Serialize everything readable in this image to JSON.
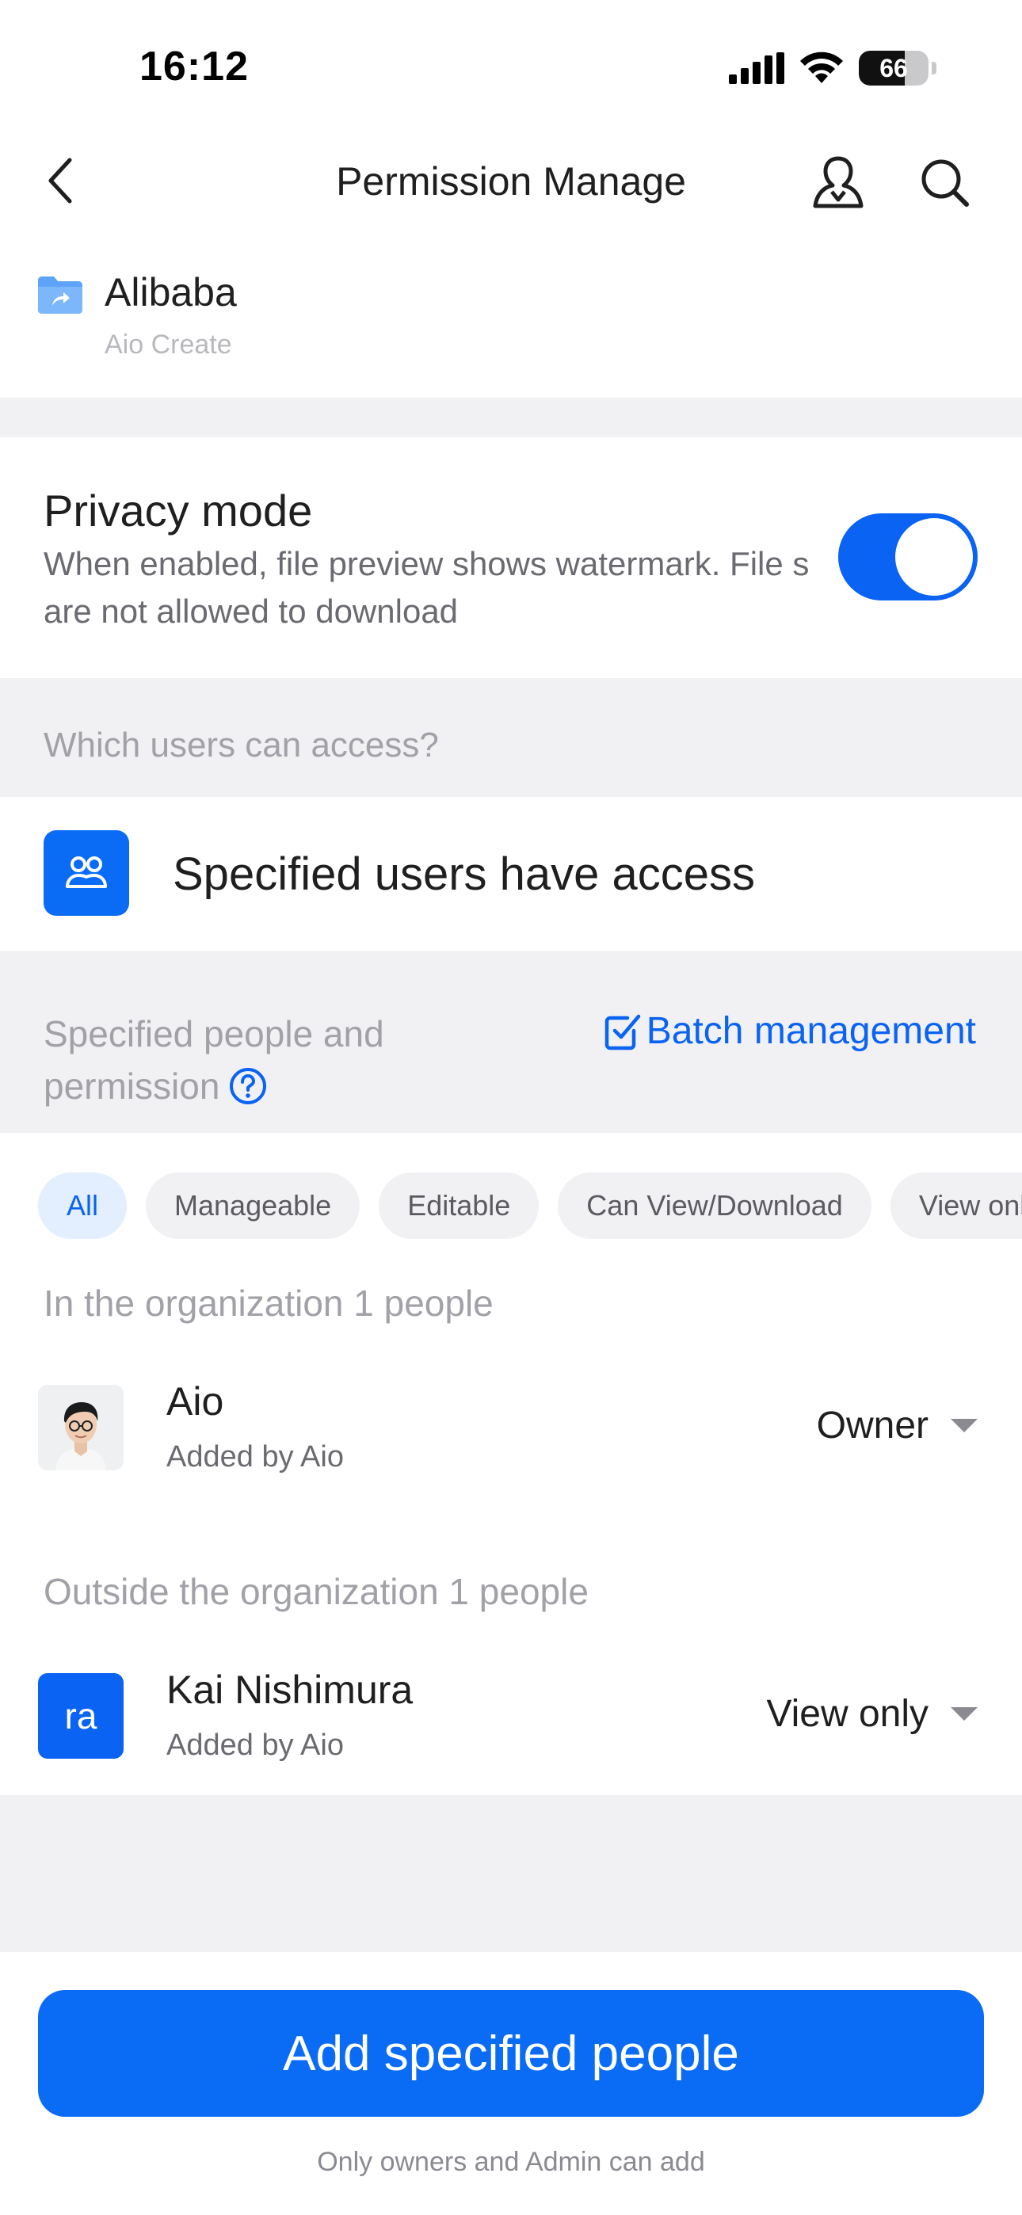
{
  "status": {
    "time": "16:12",
    "battery": "66",
    "battery_level": 0.66
  },
  "nav": {
    "title": "Permission Manage",
    "icons": [
      "back-icon",
      "user-icon",
      "search-icon"
    ]
  },
  "file": {
    "name": "Alibaba",
    "creator": "Aio Create",
    "icon": "shared-folder-icon"
  },
  "privacy": {
    "title": "Privacy mode",
    "description": "When enabled, file preview shows watermark. File s are not allowed to download",
    "enabled": true
  },
  "access": {
    "question": "Which users can access?",
    "option_label": "Specified users have access",
    "icon": "group-icon"
  },
  "people_header": {
    "label": "Specified people and permission",
    "batch_label": "Batch management"
  },
  "filters": [
    {
      "label": "All",
      "active": true
    },
    {
      "label": "Manageable",
      "active": false
    },
    {
      "label": "Editable",
      "active": false
    },
    {
      "label": "Can View/Download",
      "active": false
    },
    {
      "label": "View only",
      "active": false
    }
  ],
  "sections": [
    {
      "label": "In the organization 1 people",
      "members": [
        {
          "name": "Aio",
          "added_by": "Added by Aio",
          "role": "Owner",
          "avatar_type": "photo",
          "avatar_text": ""
        }
      ]
    },
    {
      "label": "Outside the organization 1 people",
      "members": [
        {
          "name": "Kai Nishimura",
          "added_by": "Added by Aio",
          "role": "View only",
          "avatar_type": "initials",
          "avatar_text": "ra"
        }
      ]
    }
  ],
  "footer": {
    "add_label": "Add specified people",
    "hint": "Only owners and Admin can add"
  },
  "colors": {
    "accent": "#0a63f2",
    "background_band": "#f1f1f4",
    "muted_text": "#a1a1a7"
  }
}
